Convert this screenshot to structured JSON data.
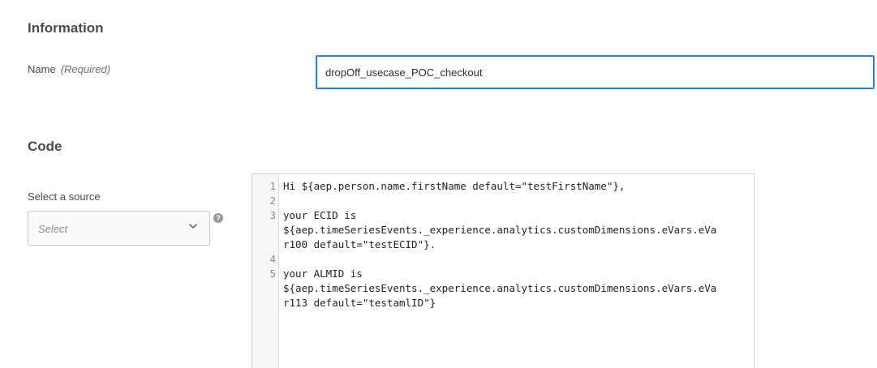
{
  "information": {
    "title": "Information",
    "name_label": "Name",
    "name_required": "(Required)",
    "name_value": "dropOff_usecase_POC_checkout"
  },
  "code": {
    "title": "Code",
    "source_label": "Select a source",
    "select_placeholder": "Select",
    "help_glyph": "?",
    "editor_lines": [
      {
        "num": "1",
        "text": "Hi ${aep.person.name.firstName default=\"testFirstName\"},"
      },
      {
        "num": "2",
        "text": ""
      },
      {
        "num": "3",
        "text": "your ECID is"
      },
      {
        "num": "",
        "text": "${aep.timeSeriesEvents._experience.analytics.customDimensions.eVars.eVa"
      },
      {
        "num": "",
        "text": "r100 default=\"testECID\"}."
      },
      {
        "num": "4",
        "text": ""
      },
      {
        "num": "5",
        "text": "your ALMID is"
      },
      {
        "num": "",
        "text": "${aep.timeSeriesEvents._experience.analytics.customDimensions.eVars.eVa"
      },
      {
        "num": "",
        "text": "r113 default=\"testamlID\"}"
      }
    ]
  }
}
